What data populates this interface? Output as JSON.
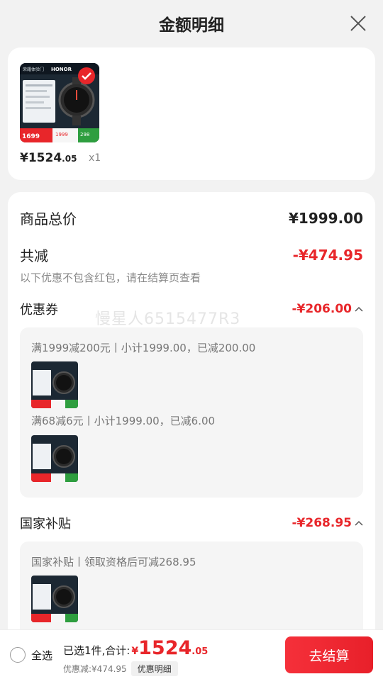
{
  "header": {
    "title": "金额明细"
  },
  "product": {
    "price_symbol": "¥",
    "price_int": "1524",
    "price_dec": ".05",
    "quantity": "x1",
    "thumb_text": {
      "brand": "HONOR",
      "store": "荣耀体验门",
      "price_badge": "1699",
      "coupon_price": "1999",
      "gift_price": "298"
    }
  },
  "summary": {
    "total_label": "商品总价",
    "total_value": "¥1999.00",
    "reduce_label": "共减",
    "reduce_value": "-¥474.95",
    "note": "以下优惠不包含红包，请在结算页查看"
  },
  "coupon": {
    "label": "优惠券",
    "value": "-¥206.00",
    "items": [
      {
        "text": "满1999减200元丨小计1999.00，已减200.00"
      },
      {
        "text": "满68减6元丨小计1999.00，已减6.00"
      }
    ]
  },
  "subsidy": {
    "label": "国家补贴",
    "value": "-¥268.95",
    "items": [
      {
        "text": "国家补贴丨领取资格后可减268.95"
      }
    ]
  },
  "watermark": "慢星人6515477R3",
  "bottom": {
    "select_all": "全选",
    "selected_label": "已选1件,合计:",
    "currency": "¥",
    "total_int": "1524",
    "total_dec": ".05",
    "discount_text": "优惠减:¥474.95",
    "discount_detail_btn": "优惠明细",
    "checkout_btn": "去结算"
  },
  "colors": {
    "accent_red": "#e8262a",
    "background": "#f2f2f2"
  }
}
